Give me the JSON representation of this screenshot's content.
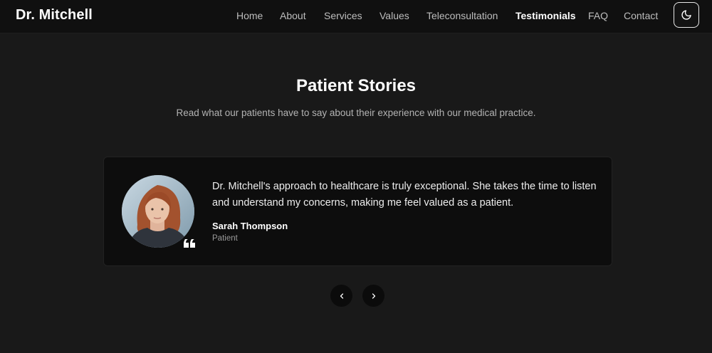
{
  "header": {
    "brand": "Dr. Mitchell",
    "nav": [
      "Home",
      "About",
      "Services",
      "Values",
      "Teleconsultation",
      "Testimonials",
      "FAQ",
      "Contact"
    ],
    "active_nav": "Testimonials",
    "theme_toggle_icon": "moon-icon"
  },
  "section": {
    "title": "Patient Stories",
    "subtitle": "Read what our patients have to say about their experience with our medical practice."
  },
  "testimonial": {
    "quote": "Dr. Mitchell's approach to healthcare is truly exceptional. She takes the time to listen and understand my concerns, making me feel valued as a patient.",
    "author": "Sarah Thompson",
    "role": "Patient"
  },
  "carousel": {
    "prev_icon": "chevron-left-icon",
    "next_icon": "chevron-right-icon"
  },
  "colors": {
    "background": "#191919",
    "header_bg": "#101010",
    "card_bg": "#0d0d0d"
  }
}
